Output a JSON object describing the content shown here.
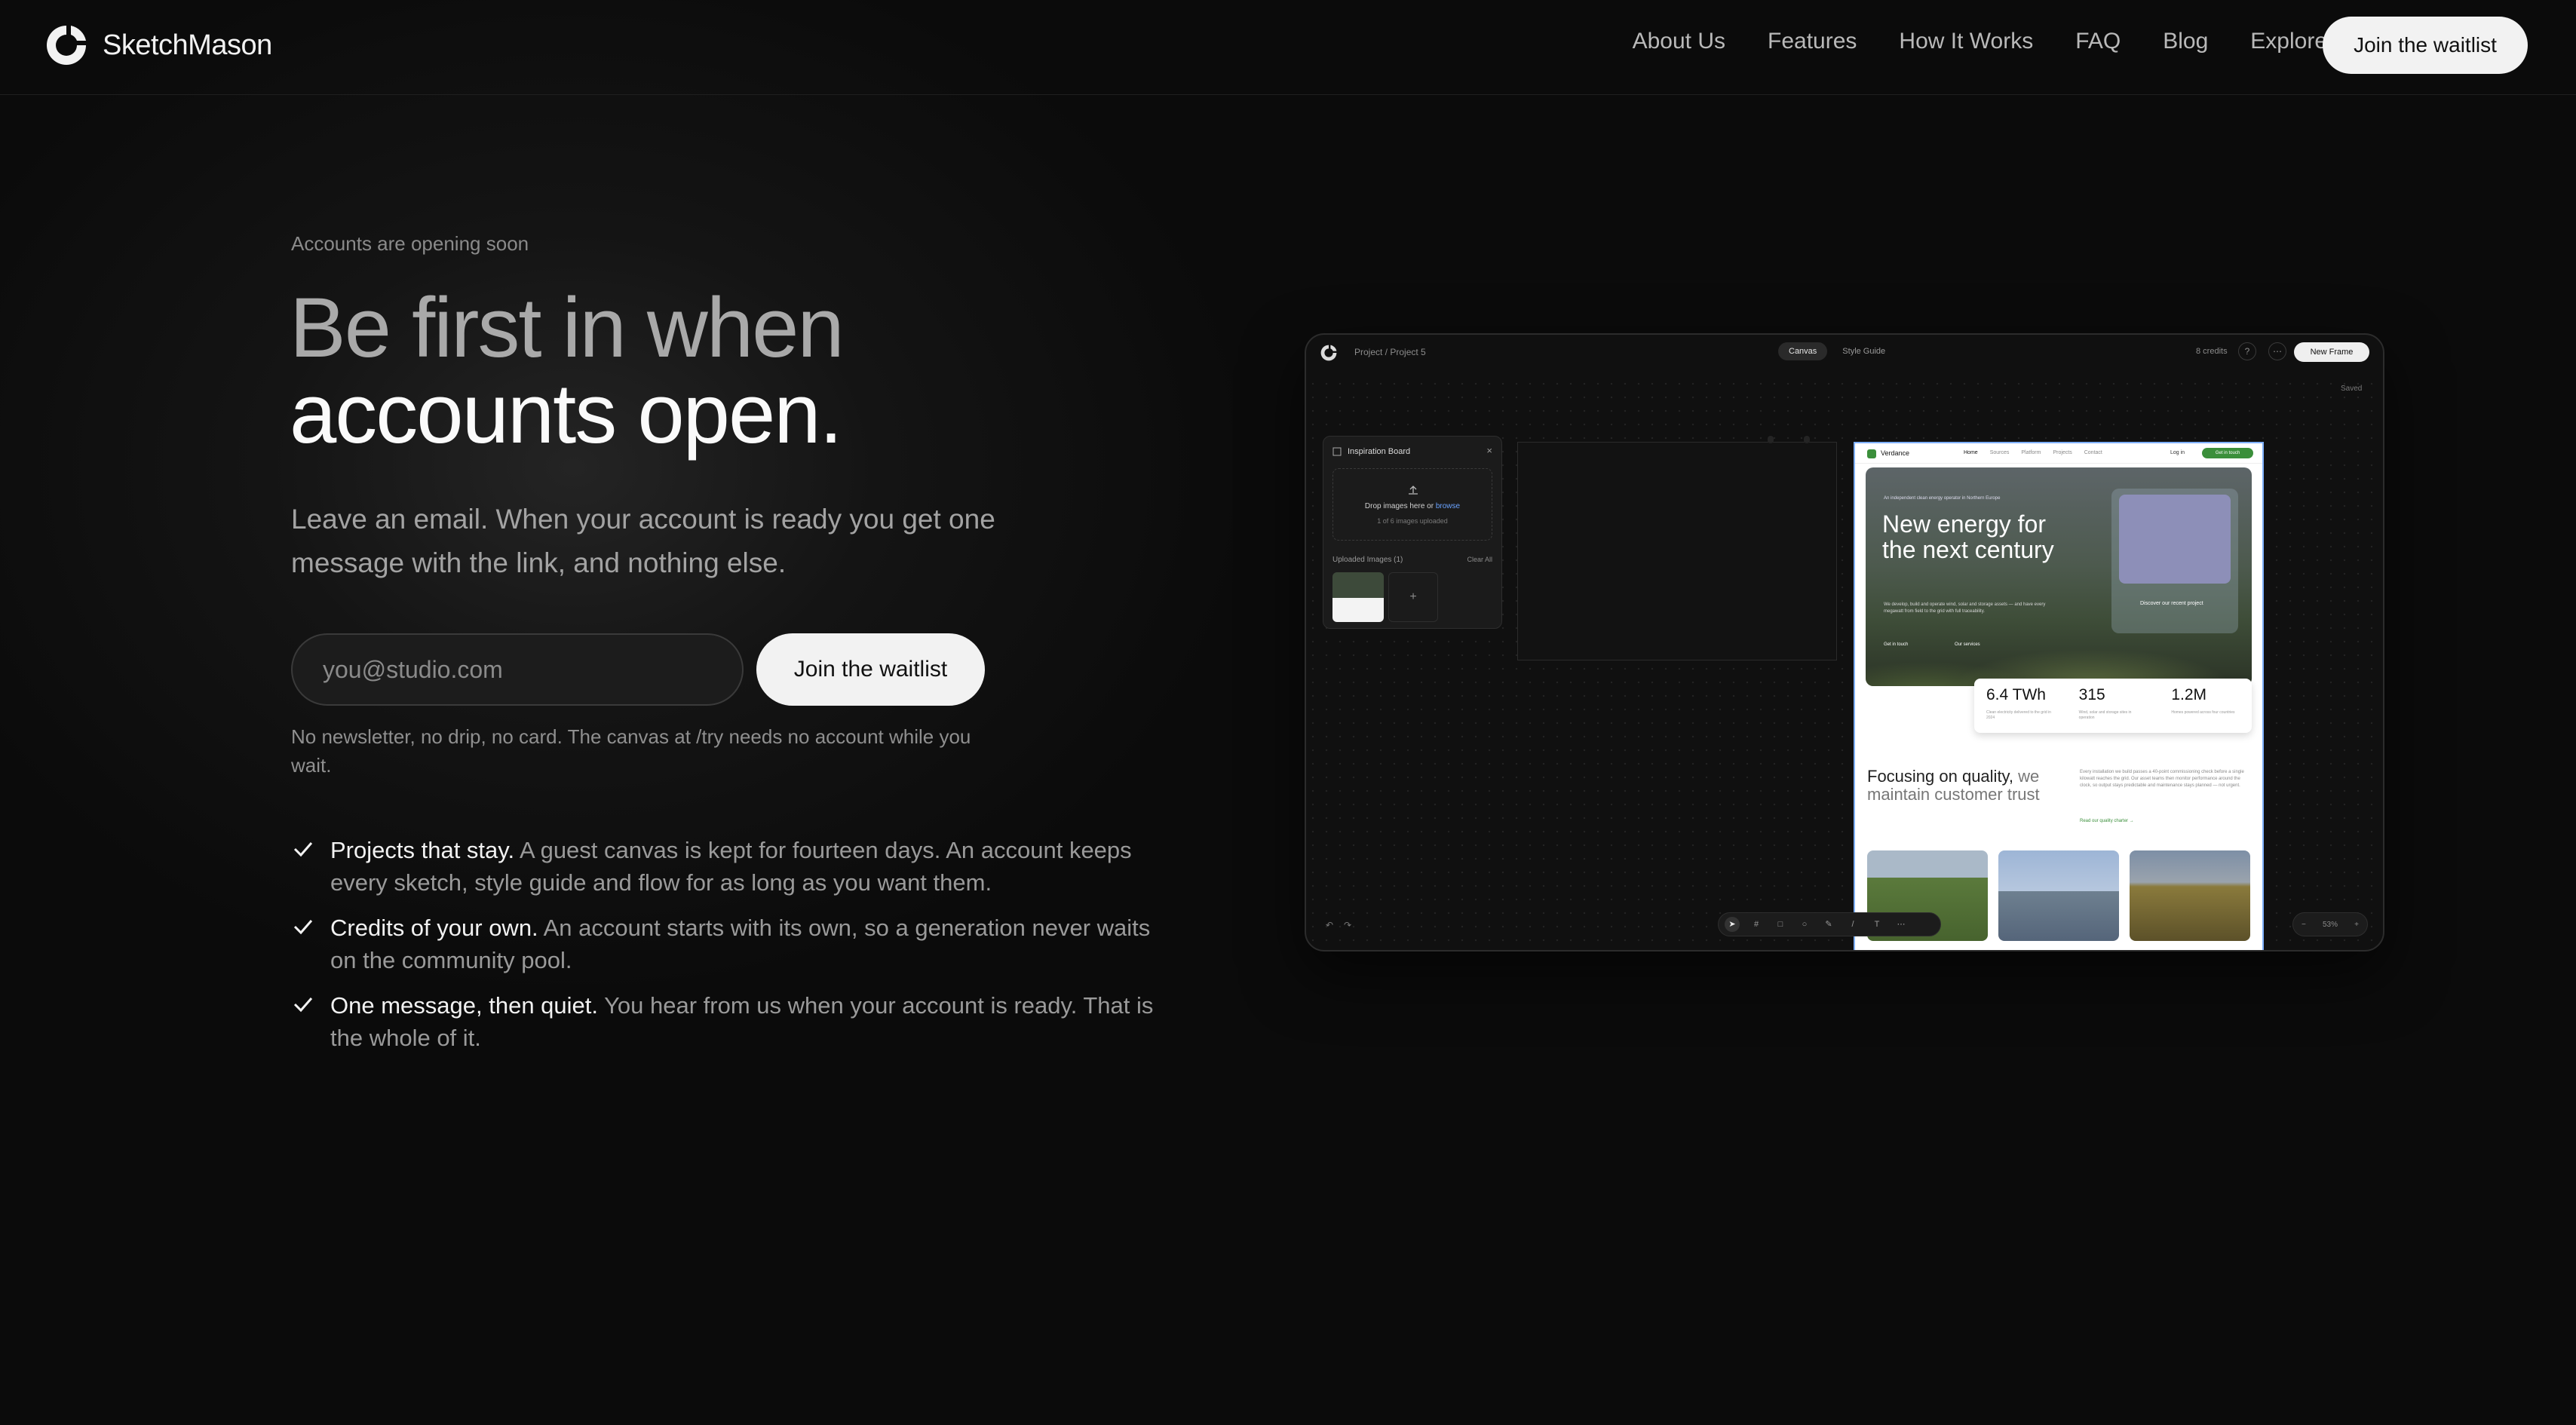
{
  "brand": {
    "name": "SketchMason"
  },
  "nav": {
    "links": [
      "About Us",
      "Features",
      "How It Works",
      "FAQ",
      "Blog",
      "Explore"
    ],
    "cta": "Join the waitlist"
  },
  "hero": {
    "eyebrow": "Accounts are opening soon",
    "headline_line1": "Be first in when",
    "headline_line2": "accounts open.",
    "lede": "Leave an email. When your account is ready you get one message with the link, and nothing else.",
    "email_placeholder": "you@studio.com",
    "cta": "Join the waitlist",
    "note": "No newsletter, no drip, no card. The canvas at /try needs no account while you wait."
  },
  "features": [
    {
      "lead": "Projects that stay.",
      "rest": "A guest canvas is kept for fourteen days. An account keeps every sketch, style guide and flow for as long as you want them."
    },
    {
      "lead": "Credits of your own.",
      "rest": "An account starts with its own, so a generation never waits on the community pool."
    },
    {
      "lead": "One message, then quiet.",
      "rest": "You hear from us when your account is ready. That is the whole of it."
    }
  ],
  "preview": {
    "breadcrumb": "Project / Project 5",
    "tabs": [
      "Canvas",
      "Style Guide"
    ],
    "credits": "8 credits",
    "new_frame": "New Frame",
    "saved": "Saved",
    "inspiration": {
      "title": "Inspiration Board",
      "drop_text": "Drop images here or",
      "browse": "browse",
      "drop_sub": "1 of 6 images uploaded",
      "uploaded_label": "Uploaded Images (1)",
      "clear": "Clear All"
    },
    "site": {
      "name": "Verdance",
      "links": [
        "Home",
        "Sources",
        "Platform",
        "Projects",
        "Contact"
      ],
      "login": "Log in",
      "get": "Get in touch",
      "hero_small": "An independent clean energy operator in Northern Europe",
      "hero_title": "New energy for the next century",
      "hero_desc": "We develop, build and operate wind, solar and storage assets — and have every megawatt from field to the grid with full traceability.",
      "btn1": "Get in touch",
      "btn2": "Our services",
      "card_text": "Discover our recent project",
      "stats": [
        {
          "value": "6.4 TWh",
          "desc": "Clean electricity delivered to the grid in 2024"
        },
        {
          "value": "315",
          "desc": "Wind, solar and storage sites in operation"
        },
        {
          "value": "1.2M",
          "desc": "Homes powered across four countries"
        }
      ],
      "focus_title_a": "Focusing on quality,",
      "focus_title_b": "we maintain customer trust",
      "focus_body": "Every installation we build passes a 40-point commissioning check before a single kilowatt reaches the grid. Our asset teams then monitor performance around the clock, so output stays predictable and maintenance stays planned — not urgent.",
      "focus_link": "Read our quality charter →"
    },
    "zoom": "53%"
  }
}
